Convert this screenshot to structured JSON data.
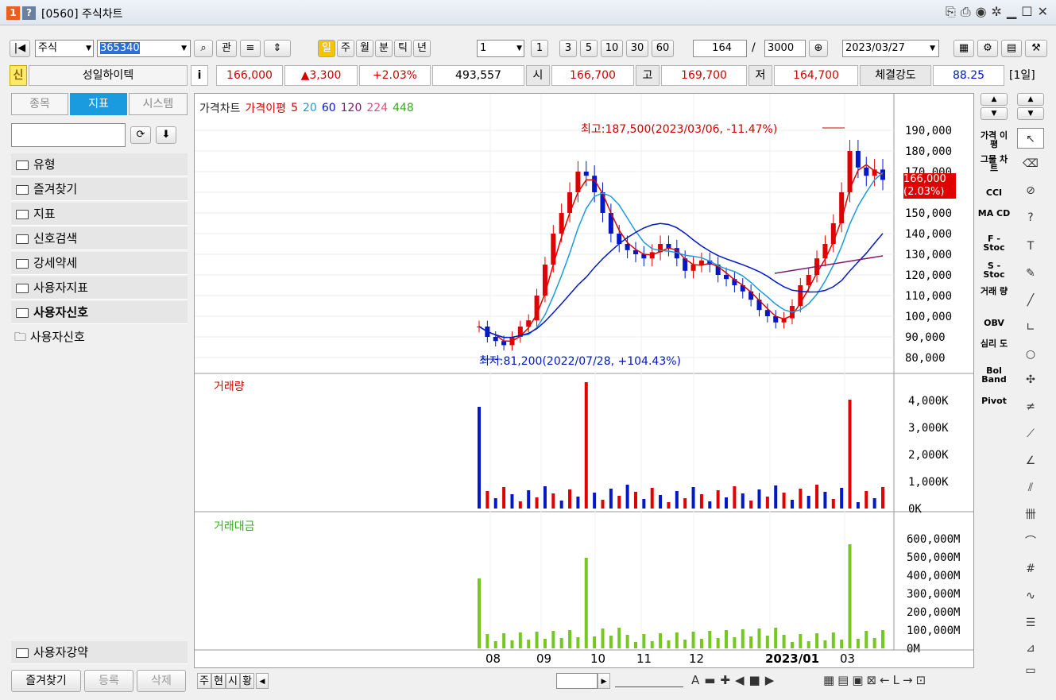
{
  "window": {
    "num": "1",
    "help": "?",
    "title": "[0560] 주식차트"
  },
  "toolbar": {
    "type": "주식",
    "code": "365340",
    "kwan": "관",
    "periods": [
      "일",
      "주",
      "월",
      "분",
      "틱",
      "년"
    ],
    "interval": "1",
    "nums": [
      "1",
      "3",
      "5",
      "10",
      "30",
      "60"
    ],
    "count": "164",
    "slash": "/",
    "total": "3000",
    "date": "2023/03/27"
  },
  "info": {
    "badge": "신",
    "name": "성일하이텍",
    "i": "i",
    "price": "166,000",
    "change": "▲3,300",
    "rate": "+2.03%",
    "volume": "493,557",
    "open_l": "시",
    "open": "166,700",
    "high_l": "고",
    "high": "169,700",
    "low_l": "저",
    "low": "164,700",
    "str_l": "체결강도",
    "str": "88.25",
    "period": "[1일]"
  },
  "left": {
    "tabs": [
      "종목",
      "지표",
      "시스템"
    ],
    "folders": [
      "유형",
      "즐겨찾기",
      "지표",
      "신호검색",
      "강세약세",
      "사용자지표",
      "사용자신호"
    ],
    "sub": "사용자신호",
    "bottom_folder": "사용자강약",
    "btns": [
      "즐겨찾기",
      "등록",
      "삭제"
    ]
  },
  "chart_data": [
    {
      "type": "candlestick",
      "title": "가격차트",
      "legend": [
        "가격이평",
        "5",
        "20",
        "60",
        "120",
        "224",
        "448"
      ],
      "y_ticks": [
        "190,000",
        "180,000",
        "170,000",
        "160,000",
        "150,000",
        "140,000",
        "130,000",
        "120,000",
        "110,000",
        "100,000",
        "90,000",
        "80,000"
      ],
      "current_price": "166,000",
      "current_rate": "(2.03%)",
      "high_annot": "최고:187,500(2023/03/06, -11.47%)",
      "low_annot": "최저:81,200(2022/07/28, +104.43%)",
      "close": [
        95000,
        90000,
        88000,
        86000,
        90000,
        95000,
        98000,
        110000,
        125000,
        140000,
        150000,
        160000,
        170000,
        168000,
        160000,
        150000,
        140000,
        135000,
        132000,
        130000,
        128000,
        131000,
        135000,
        133000,
        128000,
        122000,
        125000,
        127000,
        125000,
        120000,
        118000,
        115000,
        112000,
        108000,
        103000,
        100000,
        97000,
        99000,
        105000,
        115000,
        120000,
        128000,
        135000,
        145000,
        160000,
        180000,
        172000,
        168000,
        171000,
        166000
      ]
    },
    {
      "type": "bar",
      "title": "거래량",
      "y_ticks": [
        "4,000K",
        "3,000K",
        "2,000K",
        "1,000K",
        "0K"
      ]
    },
    {
      "type": "bar",
      "title": "거래대금",
      "y_ticks": [
        "600,000M",
        "500,000M",
        "400,000M",
        "300,000M",
        "200,000M",
        "100,000M",
        "0M"
      ]
    }
  ],
  "x_labels": [
    "08",
    "09",
    "10",
    "11",
    "12",
    "2023/01",
    "03"
  ],
  "right_ind": [
    "가격 이평",
    "그물 차트",
    "CCI",
    "MA CD",
    "F - Stoc",
    "S - Stoc",
    "거래 량",
    "OBV",
    "심리 도",
    "Bol Band",
    "Pivot"
  ],
  "bottom": {
    "tabs": [
      "주",
      "현",
      "시",
      "황"
    ]
  }
}
